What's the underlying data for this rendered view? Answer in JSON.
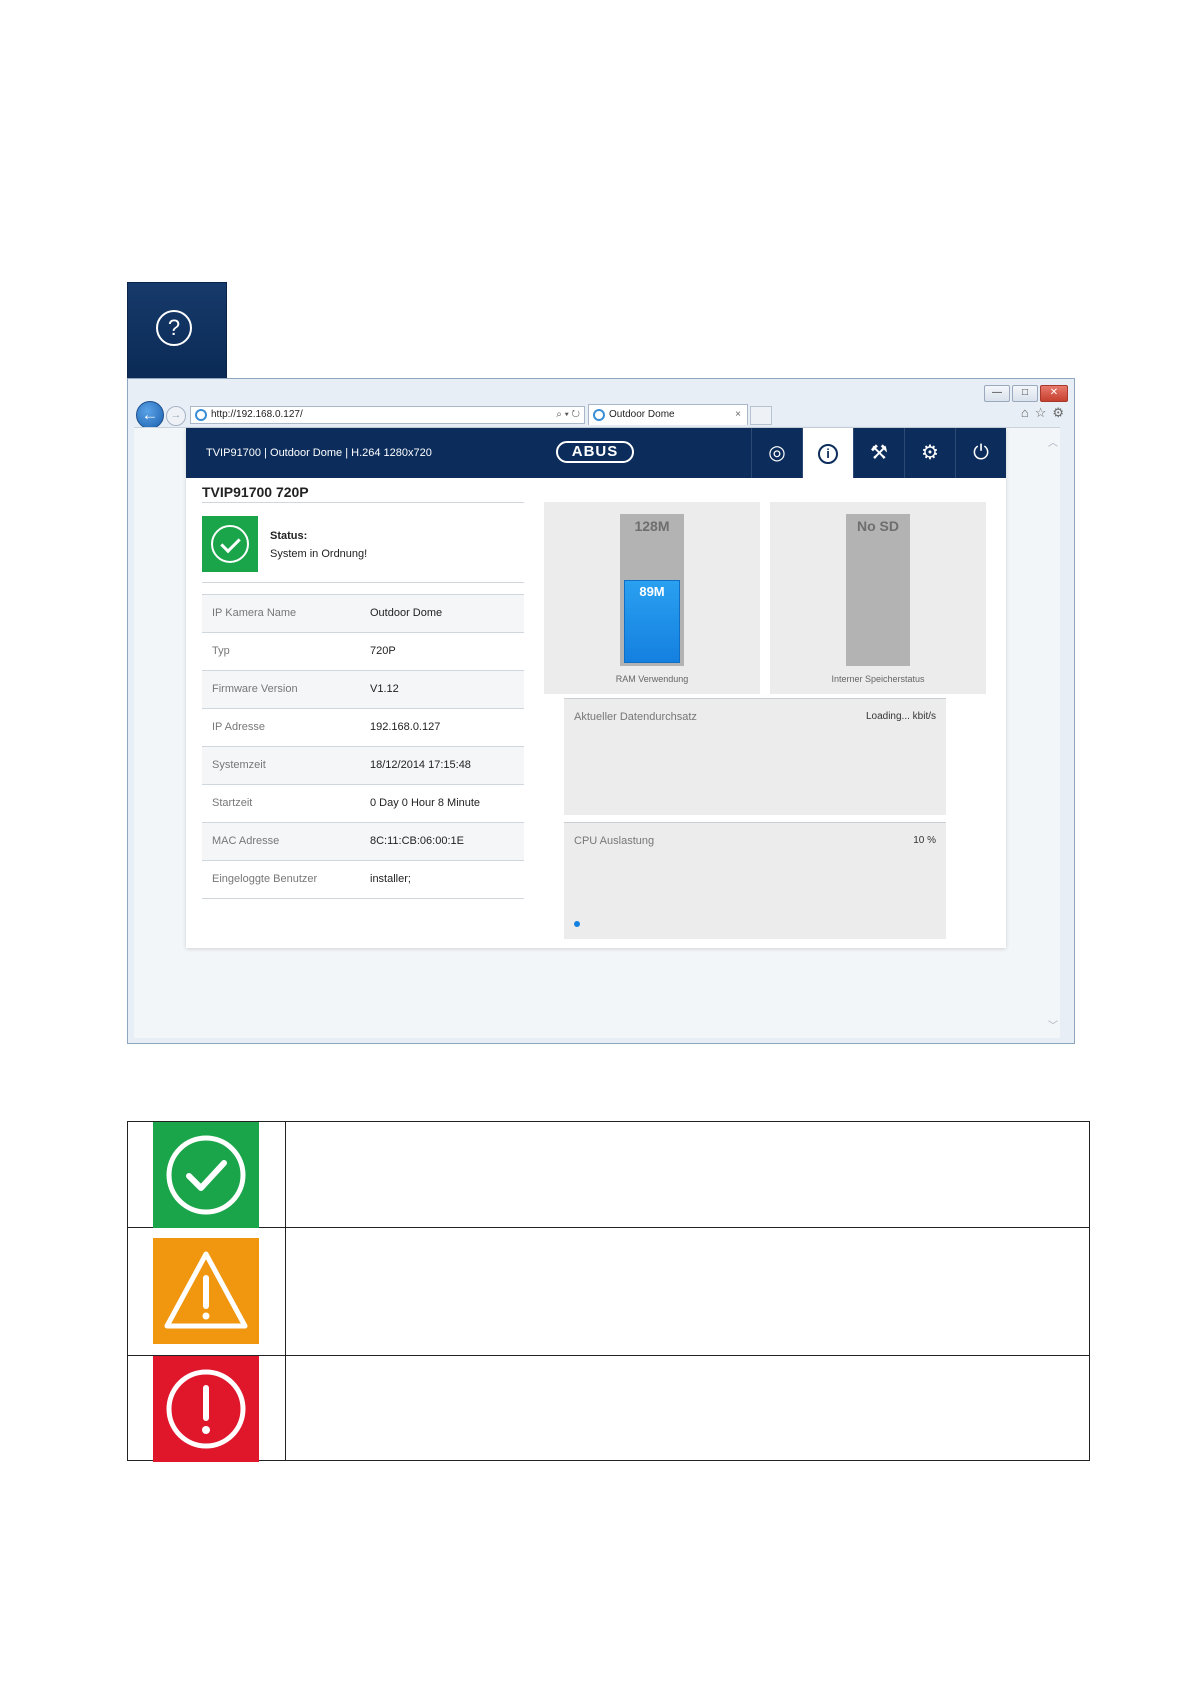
{
  "help": {
    "icon": "help-question-icon",
    "glyph": "?"
  },
  "browser": {
    "url": "http://192.168.0.127/",
    "tab_title": "Outdoor Dome",
    "tab_close": "×",
    "window_controls": {
      "minimize": "—",
      "maximize": "□",
      "close": "✕"
    },
    "toolbar_icons": [
      "home-icon",
      "star-icon",
      "gear-icon"
    ]
  },
  "app": {
    "header_title": "TVIP91700 | Outdoor Dome | H.264 1280x720",
    "logo_text": "ABUS",
    "nav": [
      {
        "name": "live-view-icon",
        "glyph": "◎"
      },
      {
        "name": "info-icon",
        "glyph": "i",
        "active": true
      },
      {
        "name": "wizard-icon",
        "glyph": "⚒"
      },
      {
        "name": "settings-icon",
        "glyph": "⚙"
      },
      {
        "name": "power-icon",
        "glyph": "⏻"
      }
    ],
    "device_title": "TVIP91700 720P",
    "status_label": "Status:",
    "status_text": "System in Ordnung!",
    "info": [
      {
        "key": "IP Kamera Name",
        "value": "Outdoor Dome"
      },
      {
        "key": "Typ",
        "value": "720P"
      },
      {
        "key": "Firmware Version",
        "value": "V1.12"
      },
      {
        "key": "IP Adresse",
        "value": "192.168.0.127"
      },
      {
        "key": "Systemzeit",
        "value": "18/12/2014 17:15:48"
      },
      {
        "key": "Startzeit",
        "value": "0 Day 0 Hour 8 Minute"
      },
      {
        "key": "MAC Adresse",
        "value": "8C:11:CB:06:00:1E"
      },
      {
        "key": "Eingeloggte Benutzer",
        "value": "installer;"
      }
    ],
    "ram": {
      "total_label": "128M",
      "used_label": "89M",
      "used_fraction": 0.695,
      "label": "RAM Verwendung"
    },
    "sd": {
      "label_top": "No SD",
      "label": "Interner Speicherstatus"
    },
    "throughput": {
      "label": "Aktueller Datendurchsatz",
      "value": "Loading... kbit/s"
    },
    "cpu": {
      "label": "CPU Auslastung",
      "value": "10 %"
    }
  },
  "legend": {
    "rows": [
      {
        "icon": "ok-check-icon",
        "color": "#1aa54a",
        "text": ""
      },
      {
        "icon": "warning-triangle-icon",
        "color": "#f0960f",
        "text": ""
      },
      {
        "icon": "error-exclamation-icon",
        "color": "#e0162b",
        "text": ""
      }
    ]
  }
}
